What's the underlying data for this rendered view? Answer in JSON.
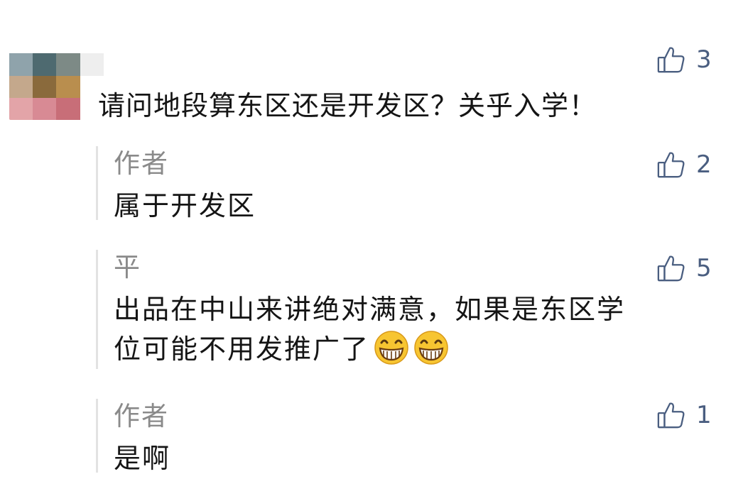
{
  "comment": {
    "text": "请问地段算东区还是开发区？关乎入学！",
    "likes": "3"
  },
  "replies": [
    {
      "author": "作者",
      "text": "属于开发区",
      "likes": "2"
    },
    {
      "author": "平",
      "text": "出品在中山来讲绝对满意，如果是东区学\n位可能不用发推广了",
      "likes": "5",
      "emojis": [
        "grinning-emoji",
        "grinning-emoji"
      ]
    },
    {
      "author": "作者",
      "text": "是啊",
      "likes": "1"
    }
  ],
  "colors": {
    "like_icon": "#4a5e80",
    "author_text": "#8a8a8a",
    "reply_border": "#e2e2e2"
  }
}
